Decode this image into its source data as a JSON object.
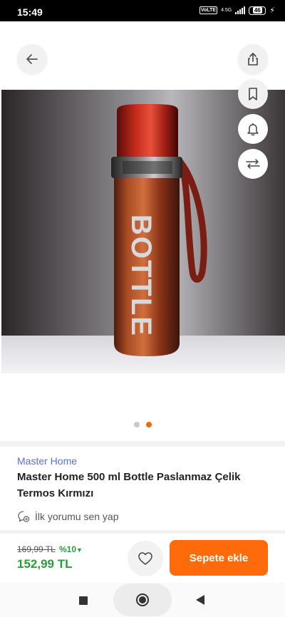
{
  "status_bar": {
    "time": "15:49",
    "volte": "VoLTE",
    "network": "4.5G",
    "battery": "46"
  },
  "colors": {
    "accent": "#ff6b0a",
    "brand_link": "#5b6fd1",
    "price_green": "#2a9d3b"
  },
  "toolbar": {
    "icons": [
      "back-arrow-icon",
      "share-icon",
      "bookmark-icon",
      "bell-icon",
      "compare-icon"
    ]
  },
  "gallery": {
    "bottle_text": "BOTTLE",
    "image_count": 2,
    "active_index": 1
  },
  "product": {
    "brand": "Master Home",
    "title": "Master Home 500 ml Bottle Paslanmaz Çelik Termos Kırmızı",
    "review_prompt": "İlk yorumu sen yap"
  },
  "pricing": {
    "old_price": "169,99 TL",
    "discount": "%10",
    "new_price": "152,99 TL"
  },
  "actions": {
    "add_to_cart": "Sepete ekle"
  }
}
